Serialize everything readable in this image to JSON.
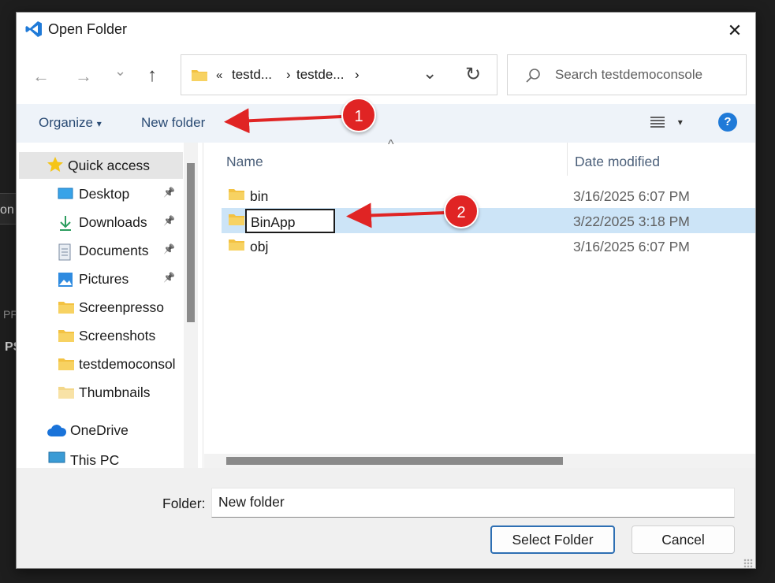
{
  "background": {
    "side_text_1": "on",
    "side_text_2": "PF",
    "side_text_3": "PS"
  },
  "window": {
    "title": "Open Folder",
    "close_glyph": "✕",
    "app_icon": "vscode-icon"
  },
  "nav": {
    "back_glyph": "←",
    "forward_glyph": "→",
    "recent_glyph": "⌄",
    "up_glyph": "↑",
    "address": {
      "overflow": "«",
      "segments": [
        "testd...",
        "testde..."
      ],
      "separator": "›"
    },
    "dropdown_glyph": "⌄",
    "refresh_glyph": "↻",
    "search_placeholder": "Search testdemoconsole"
  },
  "toolbar": {
    "organize_label": "Organize",
    "organize_caret": "▾",
    "new_folder_label": "New folder",
    "view_caret": "▾",
    "help_label": "?"
  },
  "sidebar": {
    "items": [
      {
        "label": "Quick access",
        "icon": "star-icon",
        "pinned": false,
        "selected": true
      },
      {
        "label": "Desktop",
        "icon": "desktop-icon",
        "pinned": true
      },
      {
        "label": "Downloads",
        "icon": "download-icon",
        "pinned": true
      },
      {
        "label": "Documents",
        "icon": "documents-icon",
        "pinned": true
      },
      {
        "label": "Pictures",
        "icon": "pictures-icon",
        "pinned": true
      },
      {
        "label": "Screenpresso",
        "icon": "folder-icon",
        "pinned": false
      },
      {
        "label": "Screenshots",
        "icon": "folder-icon",
        "pinned": false
      },
      {
        "label": "testdemoconsol",
        "icon": "folder-icon",
        "pinned": false
      },
      {
        "label": "Thumbnails",
        "icon": "folder-icon",
        "pinned": false
      },
      {
        "label": "OneDrive",
        "icon": "onedrive-icon",
        "pinned": false
      },
      {
        "label": "This PC",
        "icon": "pc-icon",
        "pinned": false
      }
    ],
    "pin_glyph": "📌"
  },
  "files": {
    "columns": [
      "Name",
      "Date modified"
    ],
    "sort_glyph": "^",
    "rows": [
      {
        "name": "bin",
        "date": "3/16/2025 6:07 PM"
      },
      {
        "name": "BinApp",
        "date": "3/22/2025 3:18 PM",
        "editing": true
      },
      {
        "name": "obj",
        "date": "3/16/2025 6:07 PM"
      }
    ]
  },
  "footer": {
    "folder_label": "Folder:",
    "folder_value": "New folder",
    "select_button": "Select Folder",
    "cancel_button": "Cancel"
  },
  "callouts": [
    "1",
    "2"
  ],
  "colors": {
    "accent": "#1f7ad8",
    "selection": "#cce4f7",
    "callout": "#e02424",
    "folder": "#f3c242"
  }
}
